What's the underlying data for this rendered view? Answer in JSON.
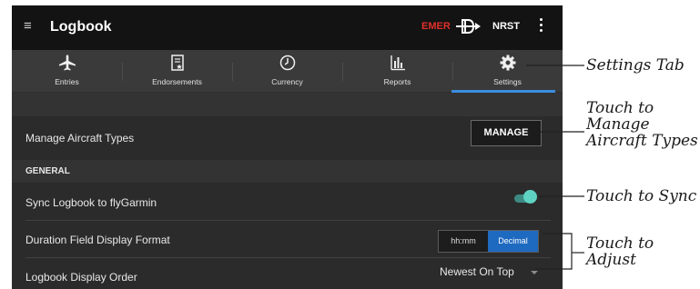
{
  "header": {
    "title": "Logbook",
    "emer_label": "EMER",
    "nrst_label": "NRST",
    "emer_color": "#e0302a"
  },
  "tabs": [
    {
      "label": "Entries",
      "icon": "airplane-icon"
    },
    {
      "label": "Endorsements",
      "icon": "document-star-icon"
    },
    {
      "label": "Currency",
      "icon": "clock-icon"
    },
    {
      "label": "Reports",
      "icon": "bar-chart-icon"
    },
    {
      "label": "Settings",
      "icon": "gear-icon",
      "selected": true
    }
  ],
  "accent_color": "#3c8ce0",
  "settings": {
    "manage_aircraft": {
      "label": "Manage Aircraft Types",
      "button": "MANAGE"
    },
    "section_general": "GENERAL",
    "sync": {
      "label": "Sync Logbook to flyGarmin",
      "enabled": true
    },
    "duration": {
      "label": "Duration Field Display Format",
      "options": [
        "hh:mm",
        "Decimal"
      ],
      "selected": "Decimal"
    },
    "display_order": {
      "label": "Logbook Display Order",
      "value": "Newest On Top"
    }
  },
  "callouts": {
    "settings_tab": "Settings Tab",
    "manage": [
      "Touch to",
      "Manage",
      "Aircraft Types"
    ],
    "sync": "Touch to Sync",
    "adjust": [
      "Touch to",
      "Adjust"
    ]
  }
}
